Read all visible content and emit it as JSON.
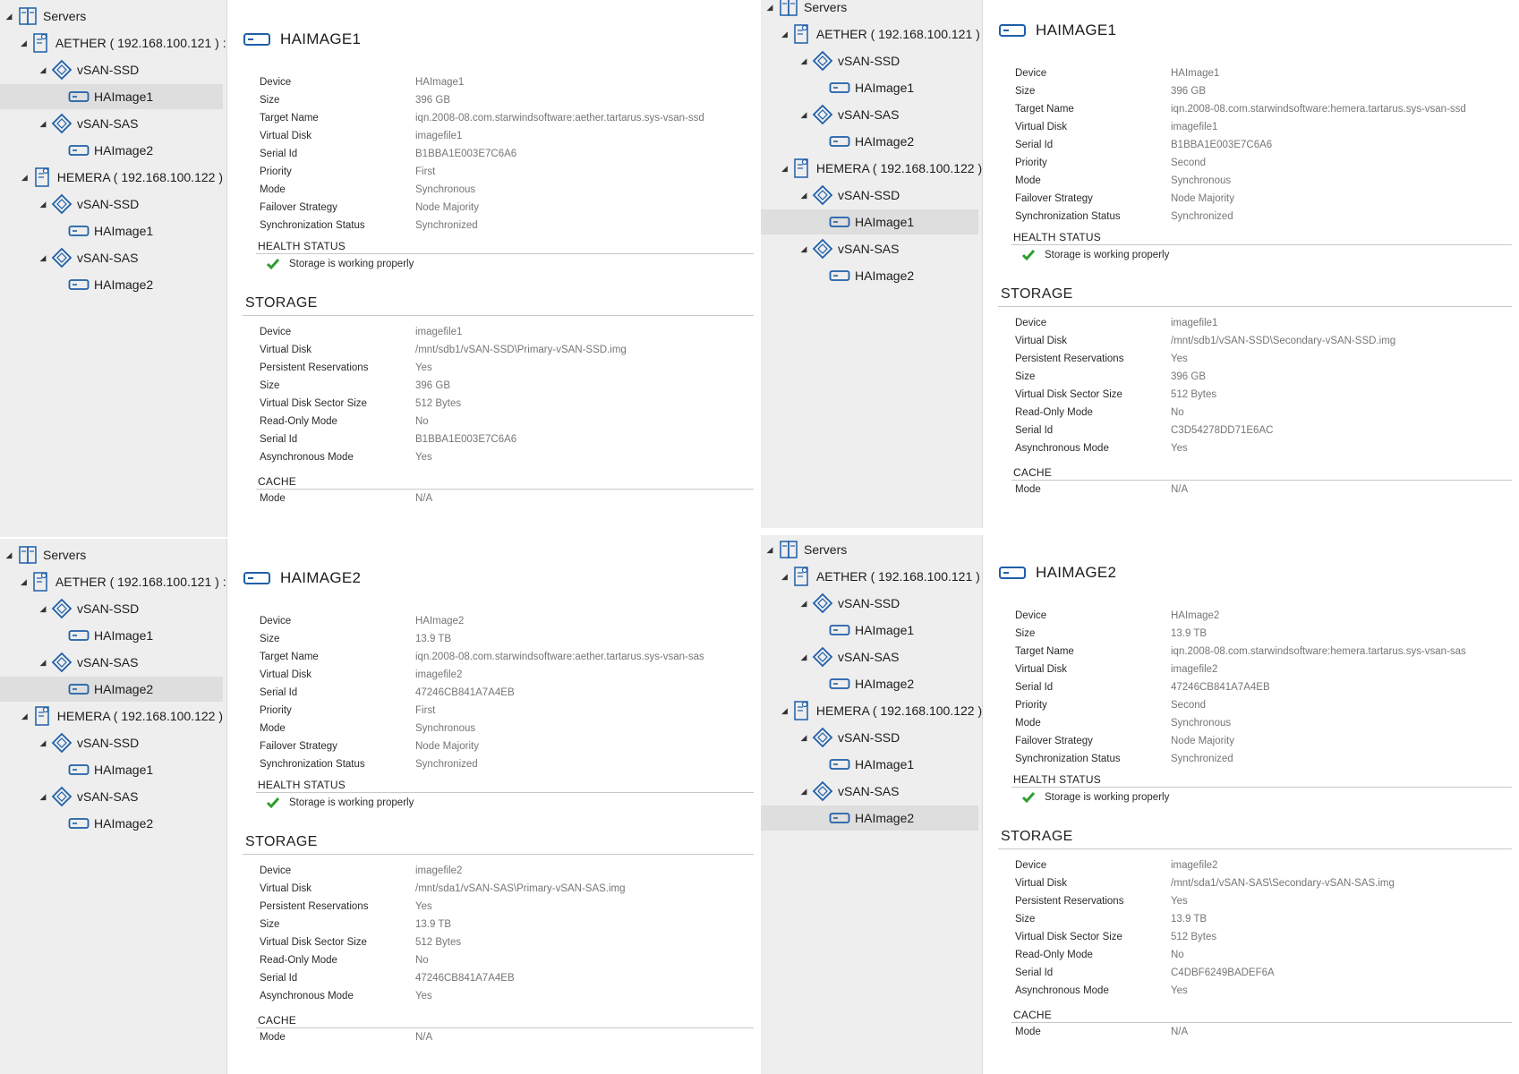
{
  "panels": [
    {
      "tree": {
        "root": "Servers",
        "servers": [
          {
            "label": "AETHER ( 192.168.100.121 ) :",
            "groups": [
              {
                "label": "vSAN-SSD",
                "items": [
                  "HAImage1"
                ]
              },
              {
                "label": "vSAN-SAS",
                "items": [
                  "HAImage2"
                ]
              }
            ]
          },
          {
            "label": "HEMERA ( 192.168.100.122 )",
            "groups": [
              {
                "label": "vSAN-SSD",
                "items": [
                  "HAImage1"
                ]
              },
              {
                "label": "vSAN-SAS",
                "items": [
                  "HAImage2"
                ]
              }
            ]
          }
        ],
        "selected": "0.0.0"
      },
      "details": {
        "title": "HAIMAGE1",
        "props": [
          {
            "k": "Device",
            "v": "HAImage1"
          },
          {
            "k": "Size",
            "v": "396 GB"
          },
          {
            "k": "Target Name",
            "v": "iqn.2008-08.com.starwindsoftware:aether.tartarus.sys-vsan-ssd"
          },
          {
            "k": "Virtual Disk",
            "v": "imagefile1"
          },
          {
            "k": "Serial Id",
            "v": "B1BBA1E003E7C6A6"
          },
          {
            "k": "Priority",
            "v": "First"
          },
          {
            "k": "Mode",
            "v": "Synchronous"
          },
          {
            "k": "Failover Strategy",
            "v": "Node Majority"
          },
          {
            "k": "Synchronization Status",
            "v": "Synchronized"
          }
        ],
        "health_title": "HEALTH STATUS",
        "health": "Storage is working properly",
        "storage_title": "STORAGE",
        "storage": [
          {
            "k": "Device",
            "v": "imagefile1"
          },
          {
            "k": "Virtual Disk",
            "v": "/mnt/sdb1/vSAN-SSD\\Primary-vSAN-SSD.img"
          },
          {
            "k": "Persistent Reservations",
            "v": "Yes"
          },
          {
            "k": "Size",
            "v": "396 GB"
          },
          {
            "k": "Virtual Disk Sector Size",
            "v": "512 Bytes"
          },
          {
            "k": "Read-Only Mode",
            "v": "No"
          },
          {
            "k": "Serial Id",
            "v": "B1BBA1E003E7C6A6"
          },
          {
            "k": "Asynchronous Mode",
            "v": "Yes"
          }
        ],
        "cache_title": "CACHE",
        "cache": [
          {
            "k": "Mode",
            "v": "N/A"
          }
        ]
      }
    },
    {
      "tree": {
        "root": "Servers",
        "servers": [
          {
            "label": "AETHER ( 192.168.100.121 ) :",
            "groups": [
              {
                "label": "vSAN-SSD",
                "items": [
                  "HAImage1"
                ]
              },
              {
                "label": "vSAN-SAS",
                "items": [
                  "HAImage2"
                ]
              }
            ]
          },
          {
            "label": "HEMERA ( 192.168.100.122 )",
            "groups": [
              {
                "label": "vSAN-SSD",
                "items": [
                  "HAImage1"
                ]
              },
              {
                "label": "vSAN-SAS",
                "items": [
                  "HAImage2"
                ]
              }
            ]
          }
        ],
        "selected": "1.0.0"
      },
      "details": {
        "title": "HAIMAGE1",
        "props": [
          {
            "k": "Device",
            "v": "HAImage1"
          },
          {
            "k": "Size",
            "v": "396 GB"
          },
          {
            "k": "Target Name",
            "v": "iqn.2008-08.com.starwindsoftware:hemera.tartarus.sys-vsan-ssd"
          },
          {
            "k": "Virtual Disk",
            "v": "imagefile1"
          },
          {
            "k": "Serial Id",
            "v": "B1BBA1E003E7C6A6"
          },
          {
            "k": "Priority",
            "v": "Second"
          },
          {
            "k": "Mode",
            "v": "Synchronous"
          },
          {
            "k": "Failover Strategy",
            "v": "Node Majority"
          },
          {
            "k": "Synchronization Status",
            "v": "Synchronized"
          }
        ],
        "health_title": "HEALTH STATUS",
        "health": "Storage is working properly",
        "storage_title": "STORAGE",
        "storage": [
          {
            "k": "Device",
            "v": "imagefile1"
          },
          {
            "k": "Virtual Disk",
            "v": "/mnt/sdb1/vSAN-SSD\\Secondary-vSAN-SSD.img"
          },
          {
            "k": "Persistent Reservations",
            "v": "Yes"
          },
          {
            "k": "Size",
            "v": "396 GB"
          },
          {
            "k": "Virtual Disk Sector Size",
            "v": "512 Bytes"
          },
          {
            "k": "Read-Only Mode",
            "v": "No"
          },
          {
            "k": "Serial Id",
            "v": "C3D54278DD71E6AC"
          },
          {
            "k": "Asynchronous Mode",
            "v": "Yes"
          }
        ],
        "cache_title": "CACHE",
        "cache": [
          {
            "k": "Mode",
            "v": "N/A"
          }
        ]
      }
    },
    {
      "tree": {
        "root": "Servers",
        "servers": [
          {
            "label": "AETHER ( 192.168.100.121 ) :",
            "groups": [
              {
                "label": "vSAN-SSD",
                "items": [
                  "HAImage1"
                ]
              },
              {
                "label": "vSAN-SAS",
                "items": [
                  "HAImage2"
                ]
              }
            ]
          },
          {
            "label": "HEMERA ( 192.168.100.122 )",
            "groups": [
              {
                "label": "vSAN-SSD",
                "items": [
                  "HAImage1"
                ]
              },
              {
                "label": "vSAN-SAS",
                "items": [
                  "HAImage2"
                ]
              }
            ]
          }
        ],
        "selected": "0.1.0"
      },
      "details": {
        "title": "HAIMAGE2",
        "props": [
          {
            "k": "Device",
            "v": "HAImage2"
          },
          {
            "k": "Size",
            "v": "13.9 TB"
          },
          {
            "k": "Target Name",
            "v": "iqn.2008-08.com.starwindsoftware:aether.tartarus.sys-vsan-sas"
          },
          {
            "k": "Virtual Disk",
            "v": "imagefile2"
          },
          {
            "k": "Serial Id",
            "v": "47246CB841A7A4EB"
          },
          {
            "k": "Priority",
            "v": "First"
          },
          {
            "k": "Mode",
            "v": "Synchronous"
          },
          {
            "k": "Failover Strategy",
            "v": "Node Majority"
          },
          {
            "k": "Synchronization Status",
            "v": "Synchronized"
          }
        ],
        "health_title": "HEALTH STATUS",
        "health": "Storage is working properly",
        "storage_title": "STORAGE",
        "storage": [
          {
            "k": "Device",
            "v": "imagefile2"
          },
          {
            "k": "Virtual Disk",
            "v": "/mnt/sda1/vSAN-SAS\\Primary-vSAN-SAS.img"
          },
          {
            "k": "Persistent Reservations",
            "v": "Yes"
          },
          {
            "k": "Size",
            "v": "13.9 TB"
          },
          {
            "k": "Virtual Disk Sector Size",
            "v": "512 Bytes"
          },
          {
            "k": "Read-Only Mode",
            "v": "No"
          },
          {
            "k": "Serial Id",
            "v": "47246CB841A7A4EB"
          },
          {
            "k": "Asynchronous Mode",
            "v": "Yes"
          }
        ],
        "cache_title": "CACHE",
        "cache": [
          {
            "k": "Mode",
            "v": "N/A"
          }
        ]
      }
    },
    {
      "tree": {
        "root": "Servers",
        "servers": [
          {
            "label": "AETHER ( 192.168.100.121 ) :",
            "groups": [
              {
                "label": "vSAN-SSD",
                "items": [
                  "HAImage1"
                ]
              },
              {
                "label": "vSAN-SAS",
                "items": [
                  "HAImage2"
                ]
              }
            ]
          },
          {
            "label": "HEMERA ( 192.168.100.122 )",
            "groups": [
              {
                "label": "vSAN-SSD",
                "items": [
                  "HAImage1"
                ]
              },
              {
                "label": "vSAN-SAS",
                "items": [
                  "HAImage2"
                ]
              }
            ]
          }
        ],
        "selected": "1.1.0"
      },
      "details": {
        "title": "HAIMAGE2",
        "props": [
          {
            "k": "Device",
            "v": "HAImage2"
          },
          {
            "k": "Size",
            "v": "13.9 TB"
          },
          {
            "k": "Target Name",
            "v": "iqn.2008-08.com.starwindsoftware:hemera.tartarus.sys-vsan-sas"
          },
          {
            "k": "Virtual Disk",
            "v": "imagefile2"
          },
          {
            "k": "Serial Id",
            "v": "47246CB841A7A4EB"
          },
          {
            "k": "Priority",
            "v": "Second"
          },
          {
            "k": "Mode",
            "v": "Synchronous"
          },
          {
            "k": "Failover Strategy",
            "v": "Node Majority"
          },
          {
            "k": "Synchronization Status",
            "v": "Synchronized"
          }
        ],
        "health_title": "HEALTH STATUS",
        "health": "Storage is working properly",
        "storage_title": "STORAGE",
        "storage": [
          {
            "k": "Device",
            "v": "imagefile2"
          },
          {
            "k": "Virtual Disk",
            "v": "/mnt/sda1/vSAN-SAS\\Secondary-vSAN-SAS.img"
          },
          {
            "k": "Persistent Reservations",
            "v": "Yes"
          },
          {
            "k": "Size",
            "v": "13.9 TB"
          },
          {
            "k": "Virtual Disk Sector Size",
            "v": "512 Bytes"
          },
          {
            "k": "Read-Only Mode",
            "v": "No"
          },
          {
            "k": "Serial Id",
            "v": "C4DBF6249BADEF6A"
          },
          {
            "k": "Asynchronous Mode",
            "v": "Yes"
          }
        ],
        "cache_title": "CACHE",
        "cache": [
          {
            "k": "Mode",
            "v": "N/A"
          }
        ]
      }
    }
  ],
  "icons": {
    "expand": "collapse-triangle-icon",
    "servers": "servers-icon",
    "server": "server-icon",
    "pool": "storage-pool-icon",
    "device": "ha-device-icon",
    "ok": "checkmark-icon"
  },
  "colors": {
    "accent": "#1f5fa8",
    "ok": "#2e9e2e",
    "sidebar_bg": "#eeeeee",
    "selection": "#dedede"
  }
}
